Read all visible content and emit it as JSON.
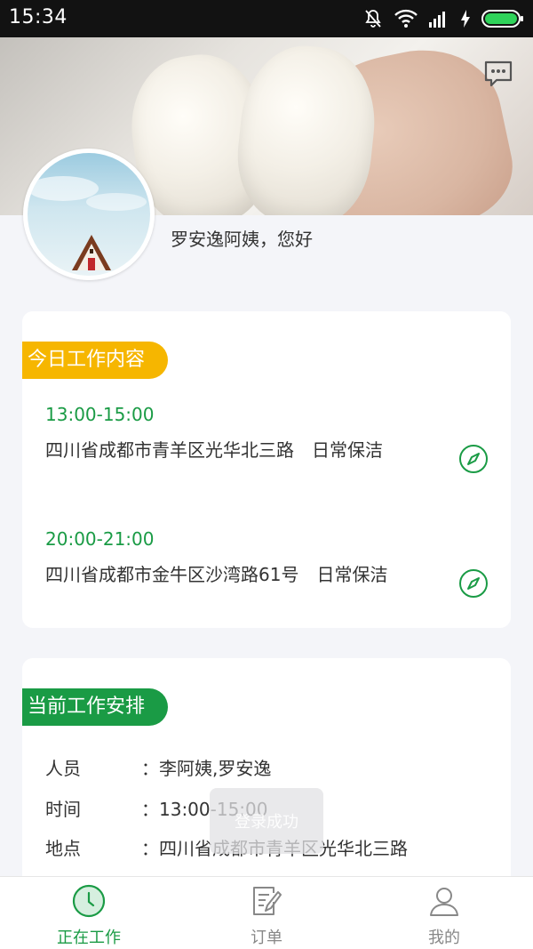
{
  "status_bar": {
    "time": "15:34"
  },
  "greeting": "罗安逸阿姨，您好",
  "today_work": {
    "title": "今日工作内容",
    "jobs": [
      {
        "time": "13:00-15:00",
        "description": "四川省成都市青羊区光华北三路　日常保洁"
      },
      {
        "time": "20:00-21:00",
        "description": "四川省成都市金牛区沙湾路61号　日常保洁"
      }
    ]
  },
  "current_work": {
    "title": "当前工作安排",
    "rows": [
      {
        "label": "人员",
        "value": "：李阿姨,罗安逸"
      },
      {
        "label": "时间",
        "value": "：13:00-15:00"
      },
      {
        "label": "地点",
        "value": "：四川省成都市青羊区光华北三路"
      }
    ]
  },
  "toast": "登录成功",
  "tabs": [
    {
      "label": "正在工作",
      "icon": "clock-icon",
      "active": true
    },
    {
      "label": "订单",
      "icon": "order-list-icon",
      "active": false
    },
    {
      "label": "我的",
      "icon": "user-icon",
      "active": false
    }
  ],
  "colors": {
    "primary_green": "#1a9b45",
    "tag_yellow": "#f6b600",
    "background": "#f4f5f9"
  }
}
